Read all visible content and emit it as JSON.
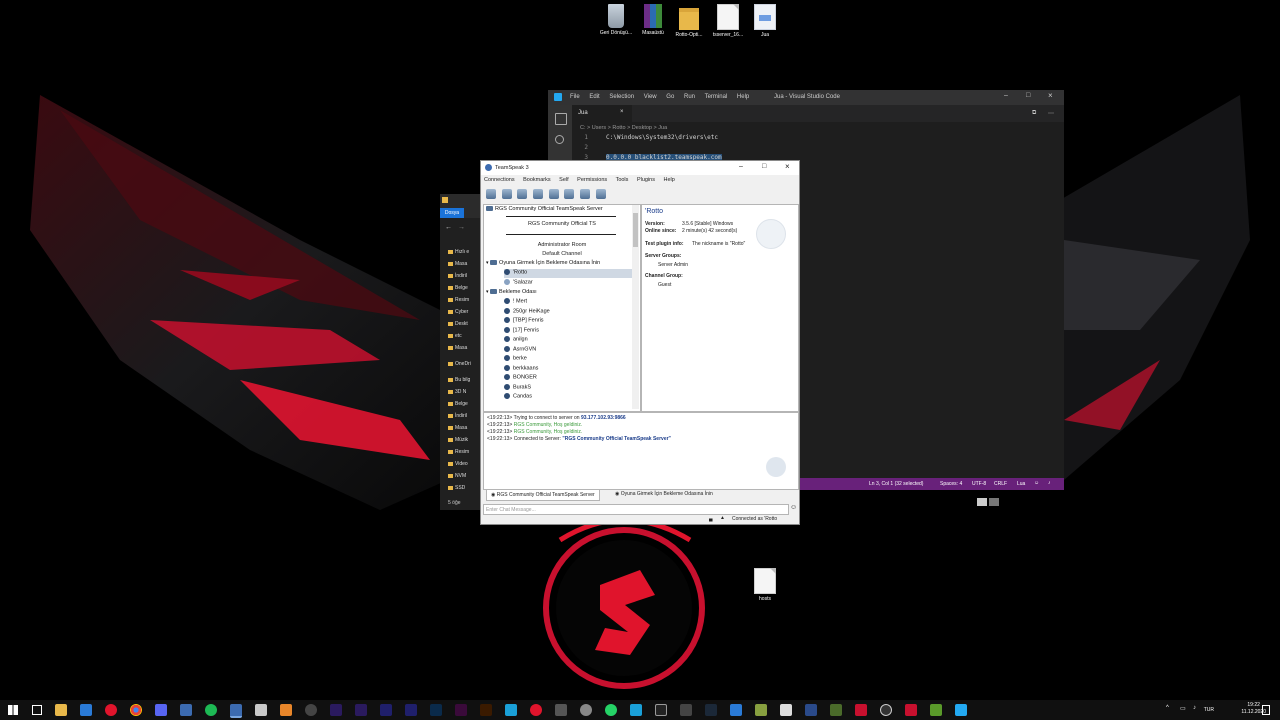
{
  "desktop": {
    "icons_top": [
      {
        "label": "Geri Dönüşü...",
        "glyph": "recycle-bin-icon",
        "kind": "bin"
      },
      {
        "label": "Masaüstü",
        "glyph": "winrar-archive-icon",
        "kind": "rar"
      },
      {
        "label": "Rotto-Opti...",
        "glyph": "folder-icon",
        "kind": "folder"
      },
      {
        "label": "tsserver_16...",
        "glyph": "file-icon",
        "kind": "file"
      },
      {
        "label": "Jua",
        "glyph": "document-icon",
        "kind": "doc"
      }
    ],
    "hosts_label": "hosts"
  },
  "vscode": {
    "title": "Jua - Visual Studio Code",
    "menu": [
      "File",
      "Edit",
      "Selection",
      "View",
      "Go",
      "Run",
      "Terminal",
      "Help"
    ],
    "tab_label": "Jua",
    "breadcrumb": "C: > Users > Rotto > Desktop > Jua",
    "lines": [
      {
        "num": "1",
        "text": "C:\\Windows\\System32\\drivers\\etc"
      },
      {
        "num": "2",
        "text": ""
      },
      {
        "num": "3",
        "text": "0.0.0.0 blacklist2.teamspeak.com"
      }
    ],
    "status": {
      "position": "Ln 3, Col 1 (32 selected)",
      "spaces": "Spaces: 4",
      "encoding": "UTF-8",
      "eol": "CRLF",
      "language": "Lua"
    }
  },
  "explorer": {
    "ribbon_tab": "Dosya",
    "items": [
      "Hızlı e",
      "Masa",
      "İndiril",
      "Belge",
      "Resim",
      "Cyber",
      "Deskt",
      "etc",
      "Masa",
      "OneDri",
      "Bu bilg",
      "3D N",
      "Belge",
      "İndiril",
      "Masa",
      "Müzik",
      "Resim",
      "Video",
      "NVM",
      "SSD"
    ],
    "status": "5 öğe"
  },
  "teamspeak": {
    "title": "TeamSpeak 3",
    "menu": [
      "Connections",
      "Bookmarks",
      "Self",
      "Permissions",
      "Tools",
      "Plugins",
      "Help"
    ],
    "tree": {
      "server": "RGS Community Official TeamSpeak Server",
      "banner": "RGS Community Official TS",
      "admin_room": "Administrator Room",
      "default_channel": "Default Channel",
      "channel1": "Oyuna Girmek İçin Bekleme Odasına İnin",
      "channel1_users": [
        "'Rotto",
        "'Salazar"
      ],
      "channel2": "Bekleme Odası",
      "channel2_users": [
        "!      Mert",
        "250gr HeiKage",
        "[TBP] Fenris",
        "[17] Fenris",
        "anilgn",
        "AsrnGVN",
        "berke",
        "berkkaans",
        "BONGER",
        "BurakS",
        "Candas"
      ]
    },
    "info": {
      "nickname": "'Rotto",
      "version_label": "Version:",
      "version_value": "3.5.6 [Stable] Windows",
      "online_label": "Online since:",
      "online_value": "2 minute(s) 42 second(s)",
      "plugin_label": "Test plugin info:",
      "plugin_value": "The nickname is \"Rotto\"",
      "server_groups_label": "Server Groups:",
      "server_group": "Server Admin",
      "channel_group_label": "Channel Group:",
      "channel_group": "Guest"
    },
    "log": [
      {
        "prefix": "<19:22:13> Trying to connect to server on ",
        "highlight": "93.177.102.93:9866",
        "color": "#333333"
      },
      {
        "prefix": "<19:22:13> ",
        "highlight": "RGS Community, Hoş geldiniz.",
        "color": "#3a9a3a"
      },
      {
        "prefix": "<19:22:13> ",
        "highlight": "RGS Community, Hoş geldiniz.",
        "color": "#3a9a3a"
      },
      {
        "prefix": "<19:22:13> Connected to Server: ",
        "highlight": "\"RGS Community Official TeamSpeak Server\"",
        "color": "#1a3c8a"
      }
    ],
    "tabs": [
      "RGS Community Official TeamSpeak Server",
      "Oyuna Girmek İçin Bekleme Odasına İnin"
    ],
    "chat_placeholder": "Enter Chat Message...",
    "status": "Connected as 'Rotto"
  },
  "taskbar": {
    "lang": "TUR",
    "time": "19:22",
    "date": "11.12.2020"
  },
  "colors": {
    "vs_status": "#68217a",
    "accent_red": "#e0142c"
  }
}
